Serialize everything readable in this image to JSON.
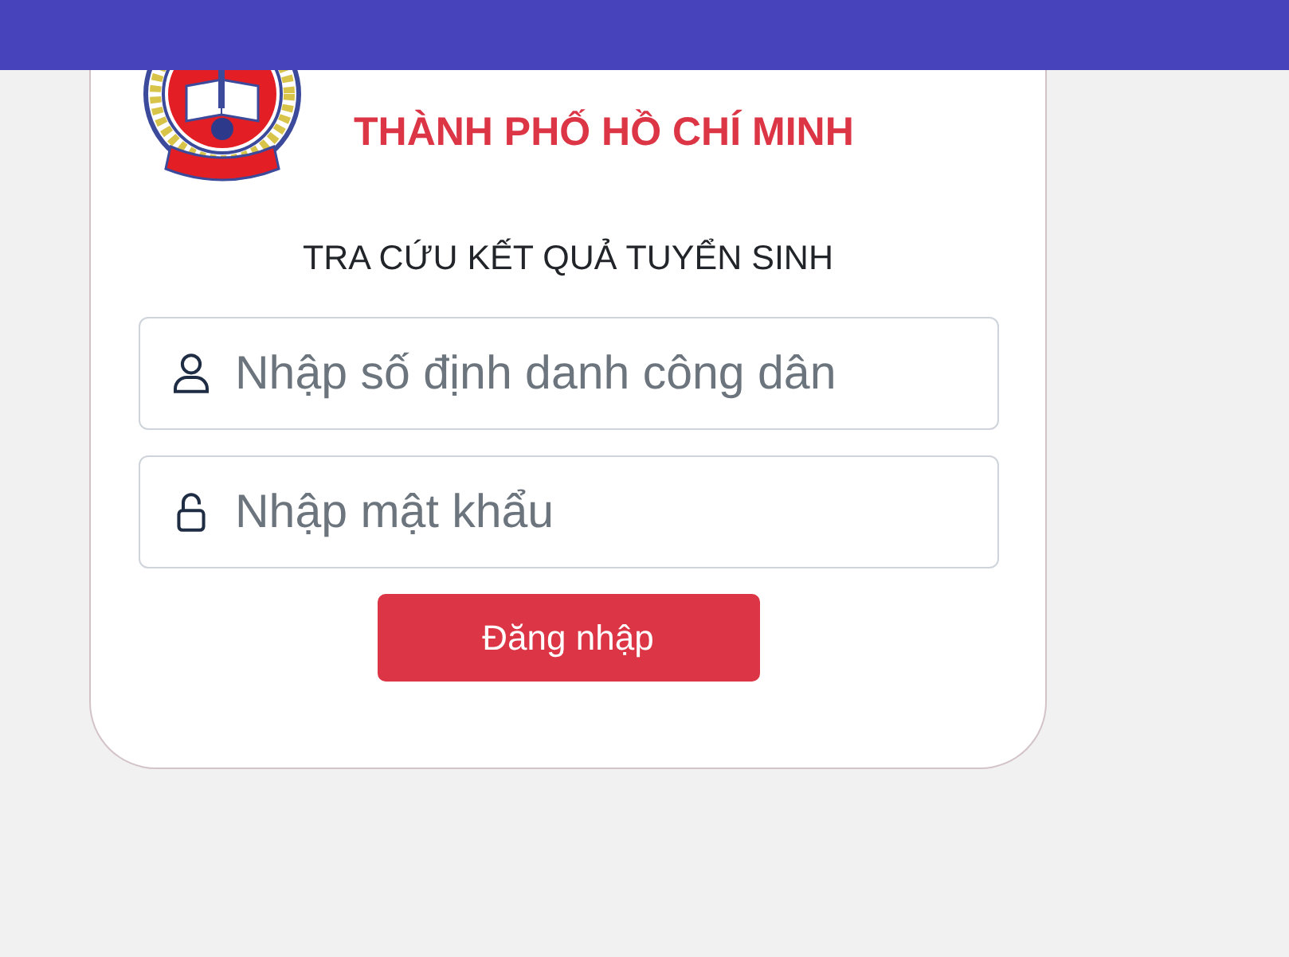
{
  "header": {
    "lines": [
      "THÀNH PHỐ HỒ CHÍ MINH"
    ]
  },
  "form": {
    "title": "TRA CỨU KẾT QUẢ TUYỂN SINH",
    "fields": [
      {
        "kind": "text",
        "placeholder": "Nhập số định danh công dân"
      },
      {
        "kind": "password",
        "placeholder": "Nhập mật khẩu"
      }
    ],
    "submit": "Đăng nhập"
  }
}
